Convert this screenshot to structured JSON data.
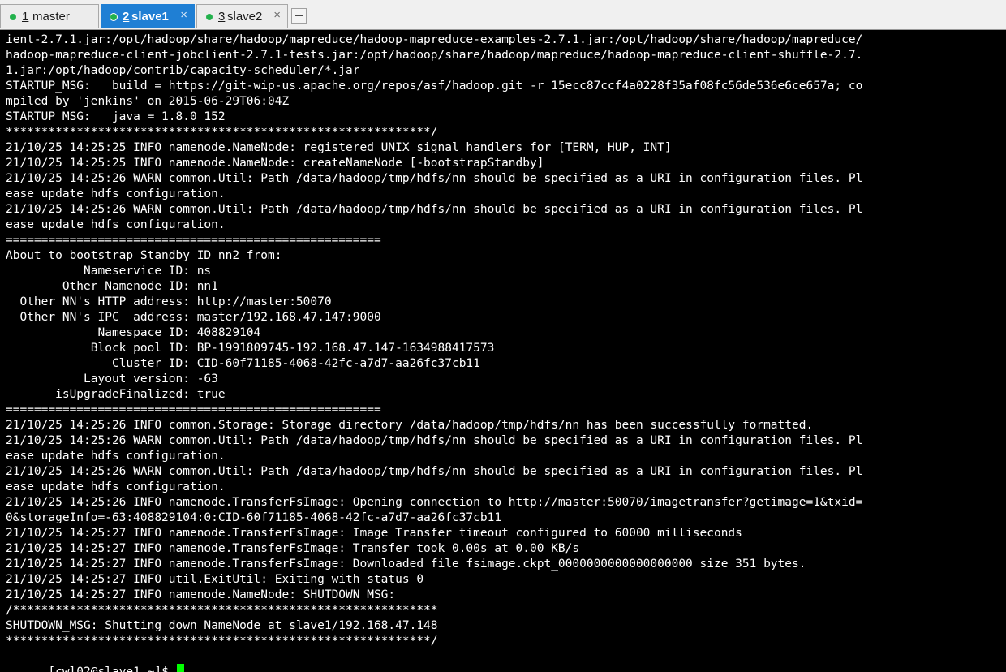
{
  "tabs": [
    {
      "number": "1",
      "label": "master",
      "status_color": "#22b14c",
      "active": false
    },
    {
      "number": "2",
      "label": "slave1",
      "status_color": "#22b14c",
      "active": true
    },
    {
      "number": "3",
      "label": "slave2",
      "status_color": "#22b14c",
      "active": false
    }
  ],
  "tab_close_glyph": "×",
  "new_tab_icon": "plus-icon",
  "terminal": {
    "lines": [
      "ient-2.7.1.jar:/opt/hadoop/share/hadoop/mapreduce/hadoop-mapreduce-examples-2.7.1.jar:/opt/hadoop/share/hadoop/mapreduce/",
      "hadoop-mapreduce-client-jobclient-2.7.1-tests.jar:/opt/hadoop/share/hadoop/mapreduce/hadoop-mapreduce-client-shuffle-2.7.",
      "1.jar:/opt/hadoop/contrib/capacity-scheduler/*.jar",
      "STARTUP_MSG:   build = https://git-wip-us.apache.org/repos/asf/hadoop.git -r 15ecc87ccf4a0228f35af08fc56de536e6ce657a; co",
      "mpiled by 'jenkins' on 2015-06-29T06:04Z",
      "STARTUP_MSG:   java = 1.8.0_152",
      "************************************************************/",
      "21/10/25 14:25:25 INFO namenode.NameNode: registered UNIX signal handlers for [TERM, HUP, INT]",
      "21/10/25 14:25:25 INFO namenode.NameNode: createNameNode [-bootstrapStandby]",
      "21/10/25 14:25:26 WARN common.Util: Path /data/hadoop/tmp/hdfs/nn should be specified as a URI in configuration files. Pl",
      "ease update hdfs configuration.",
      "21/10/25 14:25:26 WARN common.Util: Path /data/hadoop/tmp/hdfs/nn should be specified as a URI in configuration files. Pl",
      "ease update hdfs configuration.",
      "=====================================================",
      "About to bootstrap Standby ID nn2 from:",
      "           Nameservice ID: ns",
      "        Other Namenode ID: nn1",
      "  Other NN's HTTP address: http://master:50070",
      "  Other NN's IPC  address: master/192.168.47.147:9000",
      "             Namespace ID: 408829104",
      "            Block pool ID: BP-1991809745-192.168.47.147-1634988417573",
      "               Cluster ID: CID-60f71185-4068-42fc-a7d7-aa26fc37cb11",
      "           Layout version: -63",
      "       isUpgradeFinalized: true",
      "=====================================================",
      "21/10/25 14:25:26 INFO common.Storage: Storage directory /data/hadoop/tmp/hdfs/nn has been successfully formatted.",
      "21/10/25 14:25:26 WARN common.Util: Path /data/hadoop/tmp/hdfs/nn should be specified as a URI in configuration files. Pl",
      "ease update hdfs configuration.",
      "21/10/25 14:25:26 WARN common.Util: Path /data/hadoop/tmp/hdfs/nn should be specified as a URI in configuration files. Pl",
      "ease update hdfs configuration.",
      "21/10/25 14:25:26 INFO namenode.TransferFsImage: Opening connection to http://master:50070/imagetransfer?getimage=1&txid=",
      "0&storageInfo=-63:408829104:0:CID-60f71185-4068-42fc-a7d7-aa26fc37cb11",
      "21/10/25 14:25:27 INFO namenode.TransferFsImage: Image Transfer timeout configured to 60000 milliseconds",
      "21/10/25 14:25:27 INFO namenode.TransferFsImage: Transfer took 0.00s at 0.00 KB/s",
      "21/10/25 14:25:27 INFO namenode.TransferFsImage: Downloaded file fsimage.ckpt_0000000000000000000 size 351 bytes.",
      "21/10/25 14:25:27 INFO util.ExitUtil: Exiting with status 0",
      "21/10/25 14:25:27 INFO namenode.NameNode: SHUTDOWN_MSG:",
      "/************************************************************",
      "SHUTDOWN_MSG: Shutting down NameNode at slave1/192.168.47.148",
      "************************************************************/"
    ],
    "prompt": "[cwl02@slave1 ~]$ ",
    "cursor_color": "#00ff00"
  }
}
